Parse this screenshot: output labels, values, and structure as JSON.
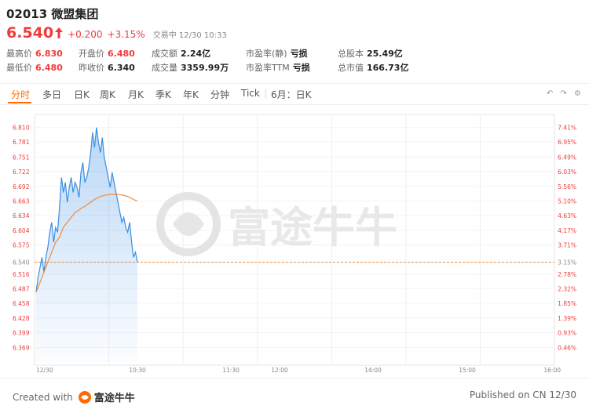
{
  "stock": {
    "code": "02013",
    "name": "微盟集团",
    "price": "6.540",
    "change": "+0.200",
    "change_pct": "+3.15%",
    "status": "交易中  12/30 10:33"
  },
  "stats": {
    "high_label": "最高价",
    "high": "6.830",
    "low_label": "最低价",
    "low": "6.480",
    "open_label": "开盘价",
    "open": "6.480",
    "prev_label": "昨收价",
    "prev": "6.340",
    "turnover_label": "成交额",
    "turnover": "2.24亿",
    "volume_label": "成交量",
    "volume": "3359.99万",
    "pe_static_label": "市盈率(静)",
    "pe_static": "亏损",
    "pe_ttm_label": "市盈率TTM",
    "pe_ttm": "亏损",
    "shares_label": "总股本",
    "shares": "25.49亿",
    "mcap_label": "总市值",
    "mcap": "166.73亿"
  },
  "tabs": [
    "分时",
    "多日",
    "日K",
    "周K",
    "月K",
    "季K",
    "年K",
    "分钟",
    "Tick",
    "6月：日K"
  ],
  "active_tab": "分时",
  "toolbar_icons": [
    "undo-icon",
    "redo-icon",
    "settings-icon"
  ],
  "watermark": "富途牛牛",
  "colors": {
    "up": "#f03b3b",
    "down": "#1aa35a",
    "price_line": "#3a8ee6",
    "avg_line": "#f08a3c",
    "active_tab": "#ff6a00"
  },
  "chart_data": {
    "type": "line",
    "ylim": [
      6.34,
      6.83
    ],
    "y_ticks_left": [
      "6.810",
      "6.781",
      "6.751",
      "6.722",
      "6.692",
      "6.663",
      "6.634",
      "6.604",
      "6.575",
      "6.540",
      "6.516",
      "6.487",
      "6.458",
      "6.428",
      "6.399",
      "6.369"
    ],
    "y_ticks_right": [
      "7.41%",
      "6.95%",
      "6.49%",
      "6.03%",
      "5.56%",
      "5.10%",
      "4.63%",
      "4.17%",
      "3.71%",
      "3.15%",
      "2.78%",
      "2.32%",
      "1.85%",
      "1.39%",
      "0.93%",
      "0.46%"
    ],
    "x_ticks": [
      "12/30",
      "10:30",
      "11:30",
      "12:00",
      "14:00",
      "15:00",
      "16:00"
    ],
    "reference_price": 6.54,
    "series": [
      {
        "values": [
          6.48,
          6.51,
          6.53,
          6.55,
          6.52,
          6.55,
          6.57,
          6.6,
          6.62,
          6.58,
          6.61,
          6.6,
          6.65,
          6.71,
          6.68,
          6.7,
          6.66,
          6.69,
          6.71,
          6.68,
          6.7,
          6.69,
          6.67,
          6.72,
          6.74,
          6.7,
          6.71,
          6.73,
          6.76,
          6.8,
          6.77,
          6.81,
          6.78,
          6.76,
          6.79,
          6.75,
          6.73,
          6.71,
          6.69,
          6.72,
          6.7,
          6.68,
          6.66,
          6.64,
          6.62,
          6.63,
          6.61,
          6.6,
          6.62,
          6.58,
          6.55,
          6.56,
          6.54
        ]
      },
      {
        "values": [
          6.48,
          6.49,
          6.5,
          6.51,
          6.52,
          6.53,
          6.54,
          6.55,
          6.56,
          6.57,
          6.58,
          6.585,
          6.59,
          6.6,
          6.61,
          6.615,
          6.62,
          6.625,
          6.63,
          6.635,
          6.64,
          6.642,
          6.645,
          6.648,
          6.65,
          6.652,
          6.655,
          6.658,
          6.66,
          6.663,
          6.666,
          6.668,
          6.67,
          6.672,
          6.673,
          6.674,
          6.675,
          6.675,
          6.676,
          6.676,
          6.676,
          6.676,
          6.676,
          6.675,
          6.675,
          6.674,
          6.673,
          6.672,
          6.67,
          6.668,
          6.666,
          6.664,
          6.663
        ]
      }
    ]
  }
}
